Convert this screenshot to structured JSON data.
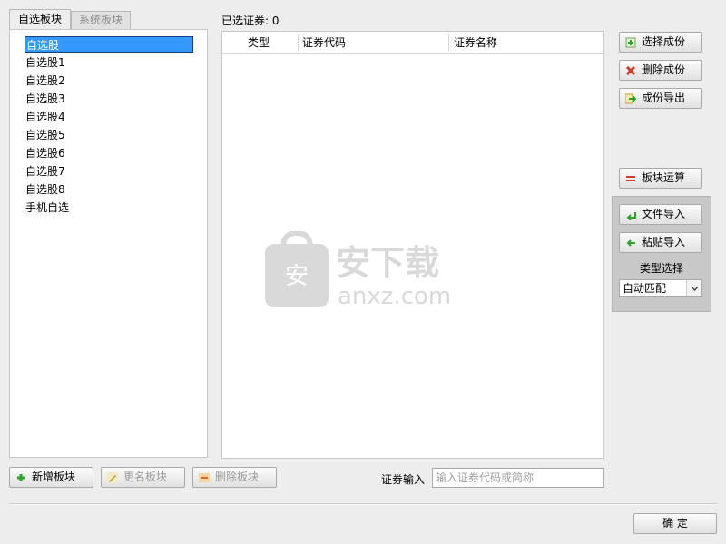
{
  "tabs": [
    {
      "label": "自选板块",
      "active": true
    },
    {
      "label": "系统板块",
      "active": false
    }
  ],
  "blocks": {
    "items": [
      "自选股",
      "自选股1",
      "自选股2",
      "自选股3",
      "自选股4",
      "自选股5",
      "自选股6",
      "自选股7",
      "自选股8",
      "手机自选"
    ],
    "selected_index": 0
  },
  "selected_count_text": "已选证券: 0",
  "table": {
    "columns": [
      "类型",
      "证券代码",
      "证券名称"
    ],
    "rows": []
  },
  "right_buttons": {
    "select_components": "选择成份",
    "delete_components": "删除成份",
    "export_components": "成份导出",
    "block_operation": "板块运算",
    "file_import": "文件导入",
    "paste_import": "粘贴导入"
  },
  "type_select": {
    "label": "类型选择",
    "value": "自动匹配"
  },
  "bottom_buttons": {
    "add_block": "新增板块",
    "rename_block": "更名板块",
    "delete_block": "删除板块"
  },
  "security_input": {
    "label": "证券输入",
    "placeholder": "输入证券代码或简称",
    "value": ""
  },
  "confirm_label": "确 定",
  "watermark": {
    "text": "安下载",
    "subtext": "anxz.com",
    "badge": "安"
  },
  "colors": {
    "selection": "#3399ff",
    "add_icon": "#2aa52a",
    "delete_icon": "#d23a2a",
    "export_icon": "#2aa52a"
  }
}
